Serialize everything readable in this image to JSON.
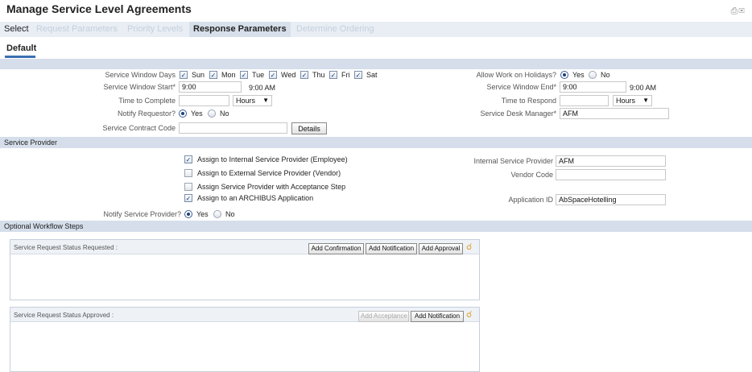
{
  "page": {
    "title": "Manage Service Level Agreements",
    "print_icon": "print-icon",
    "email_icon": "email-icon"
  },
  "tabs": [
    {
      "label": "Select",
      "state": "normal"
    },
    {
      "label": "Request Parameters",
      "state": "disabled"
    },
    {
      "label": "Priority Levels",
      "state": "disabled"
    },
    {
      "label": "Response Parameters",
      "state": "active"
    },
    {
      "label": "Determine Ordering",
      "state": "disabled"
    }
  ],
  "subtab": {
    "label": "Default"
  },
  "window": {
    "days_label": "Service Window Days",
    "days": [
      {
        "label": "Sun",
        "checked": true
      },
      {
        "label": "Mon",
        "checked": true
      },
      {
        "label": "Tue",
        "checked": true
      },
      {
        "label": "Wed",
        "checked": true
      },
      {
        "label": "Thu",
        "checked": true
      },
      {
        "label": "Fri",
        "checked": true
      },
      {
        "label": "Sat",
        "checked": false
      }
    ],
    "start_label": "Service Window Start*",
    "start_value": "9:00",
    "start_display": "9:00 AM",
    "complete_label": "Time to Complete",
    "complete_value": "",
    "complete_unit": "Hours",
    "notify_label": "Notify Requestor?",
    "notify_yes": "Yes",
    "notify_no": "No",
    "contract_label": "Service Contract Code",
    "contract_value": "",
    "details_button": "Details",
    "holidays_label": "Allow Work on Holidays?",
    "holidays_yes": "Yes",
    "holidays_no": "No",
    "end_label": "Service Window End*",
    "end_value": "9:00",
    "end_display": "9:00 AM",
    "respond_label": "Time to Respond",
    "respond_value": "",
    "respond_unit": "Hours",
    "desk_manager_label": "Service Desk Manager*",
    "desk_manager_value": "AFM"
  },
  "service_provider": {
    "section_label": "Service Provider",
    "assign_internal": "Assign to Internal Service Provider (Employee)",
    "assign_external": "Assign to External Service Provider (Vendor)",
    "assign_acceptance": "Assign Service Provider with Acceptance Step",
    "assign_archibus": "Assign to an ARCHIBUS Application",
    "internal_provider_label": "Internal Service Provider",
    "internal_provider_value": "AFM",
    "vendor_code_label": "Vendor Code",
    "vendor_code_value": "",
    "application_id_label": "Application ID",
    "application_id_value": "AbSpaceHotelling",
    "notify_label": "Notify Service Provider?",
    "notify_yes": "Yes",
    "notify_no": "No"
  },
  "workflow": {
    "section_label": "Optional Workflow Steps",
    "requested": {
      "title": "Service Request Status Requested :",
      "btn_confirmation": "Add Confirmation",
      "btn_notification": "Add Notification",
      "btn_approval": "Add Approval"
    },
    "approved": {
      "title": "Service Request Status Approved :",
      "btn_acceptance": "Add Acceptance",
      "btn_notification": "Add Notification"
    }
  },
  "colors": {
    "band": "#d5deea",
    "tabbar": "#e9eef5",
    "active_tab": "#d7e0ea",
    "accent": "#3a6fb0"
  }
}
